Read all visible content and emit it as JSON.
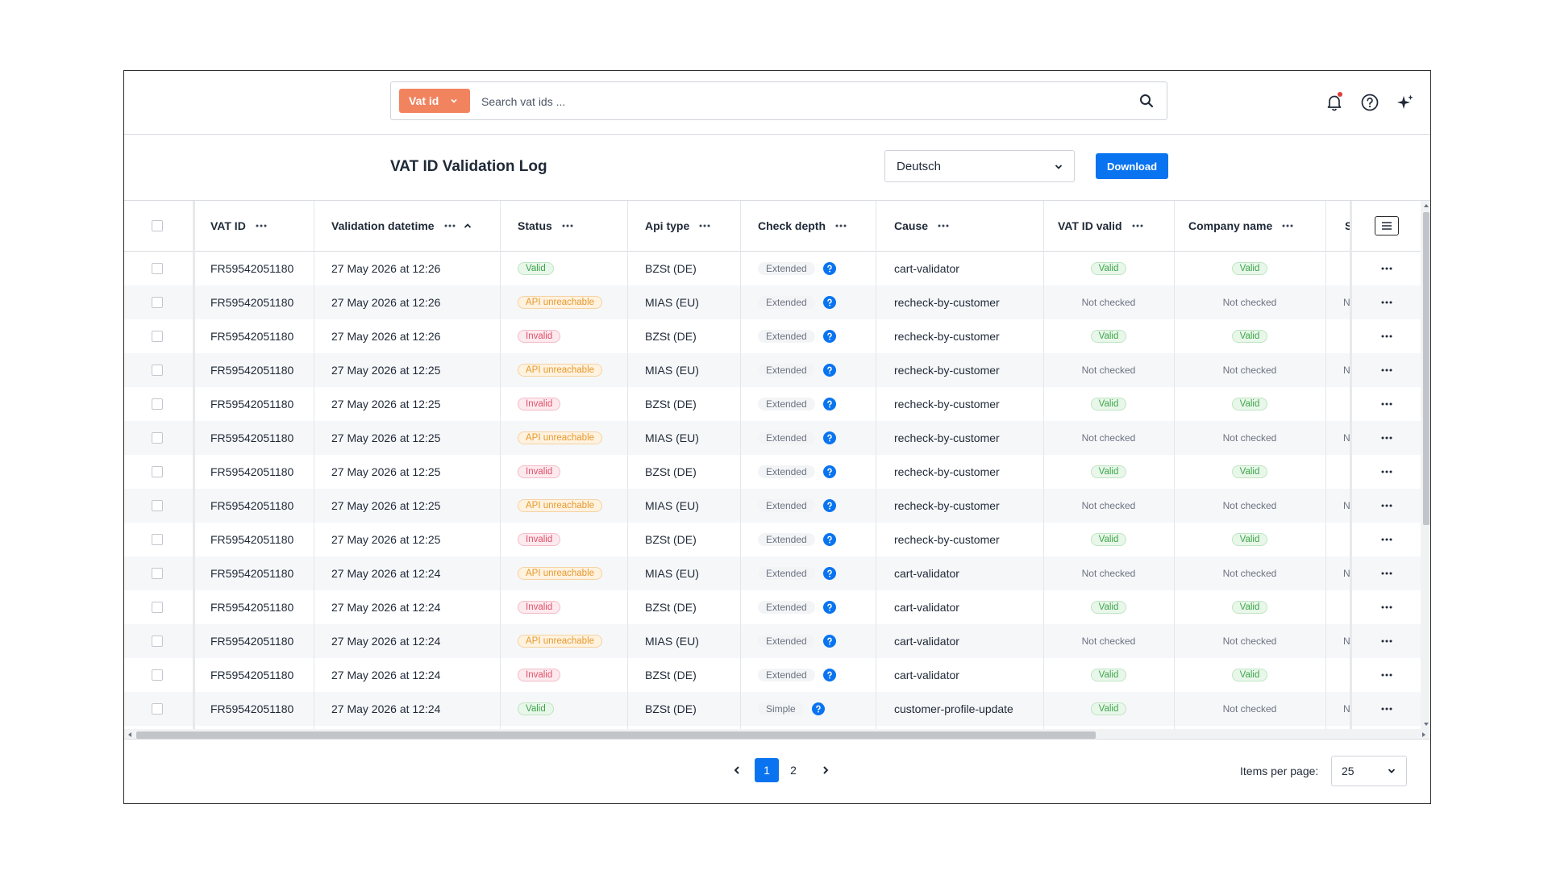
{
  "search": {
    "type_label": "Vat id",
    "placeholder": "Search vat ids ..."
  },
  "header": {
    "title": "VAT ID Validation Log",
    "language": "Deutsch",
    "download_label": "Download"
  },
  "table": {
    "columns": [
      {
        "key": "vat_id",
        "label": "VAT ID"
      },
      {
        "key": "validation_datetime",
        "label": "Validation datetime"
      },
      {
        "key": "status",
        "label": "Status"
      },
      {
        "key": "api_type",
        "label": "Api type"
      },
      {
        "key": "check_depth",
        "label": "Check depth"
      },
      {
        "key": "cause",
        "label": "Cause"
      },
      {
        "key": "vat_id_valid",
        "label": "VAT ID valid"
      },
      {
        "key": "company_name",
        "label": "Company name"
      },
      {
        "key": "partial",
        "label": "S"
      }
    ],
    "rows": [
      {
        "vat_id": "FR59542051180",
        "datetime": "27 May 2026 at 12:26",
        "status": "Valid",
        "api_type": "BZSt (DE)",
        "check_depth": "Extended",
        "cause": "cart-validator",
        "vat_id_valid": "Valid",
        "company_name": "Valid",
        "partial": ""
      },
      {
        "vat_id": "FR59542051180",
        "datetime": "27 May 2026 at 12:26",
        "status": "API unreachable",
        "api_type": "MIAS (EU)",
        "check_depth": "Extended",
        "cause": "recheck-by-customer",
        "vat_id_valid": "Not checked",
        "company_name": "Not checked",
        "partial": "N"
      },
      {
        "vat_id": "FR59542051180",
        "datetime": "27 May 2026 at 12:26",
        "status": "Invalid",
        "api_type": "BZSt (DE)",
        "check_depth": "Extended",
        "cause": "recheck-by-customer",
        "vat_id_valid": "Valid",
        "company_name": "Valid",
        "partial": ""
      },
      {
        "vat_id": "FR59542051180",
        "datetime": "27 May 2026 at 12:25",
        "status": "API unreachable",
        "api_type": "MIAS (EU)",
        "check_depth": "Extended",
        "cause": "recheck-by-customer",
        "vat_id_valid": "Not checked",
        "company_name": "Not checked",
        "partial": "N"
      },
      {
        "vat_id": "FR59542051180",
        "datetime": "27 May 2026 at 12:25",
        "status": "Invalid",
        "api_type": "BZSt (DE)",
        "check_depth": "Extended",
        "cause": "recheck-by-customer",
        "vat_id_valid": "Valid",
        "company_name": "Valid",
        "partial": ""
      },
      {
        "vat_id": "FR59542051180",
        "datetime": "27 May 2026 at 12:25",
        "status": "API unreachable",
        "api_type": "MIAS (EU)",
        "check_depth": "Extended",
        "cause": "recheck-by-customer",
        "vat_id_valid": "Not checked",
        "company_name": "Not checked",
        "partial": "N"
      },
      {
        "vat_id": "FR59542051180",
        "datetime": "27 May 2026 at 12:25",
        "status": "Invalid",
        "api_type": "BZSt (DE)",
        "check_depth": "Extended",
        "cause": "recheck-by-customer",
        "vat_id_valid": "Valid",
        "company_name": "Valid",
        "partial": ""
      },
      {
        "vat_id": "FR59542051180",
        "datetime": "27 May 2026 at 12:25",
        "status": "API unreachable",
        "api_type": "MIAS (EU)",
        "check_depth": "Extended",
        "cause": "recheck-by-customer",
        "vat_id_valid": "Not checked",
        "company_name": "Not checked",
        "partial": "N"
      },
      {
        "vat_id": "FR59542051180",
        "datetime": "27 May 2026 at 12:25",
        "status": "Invalid",
        "api_type": "BZSt (DE)",
        "check_depth": "Extended",
        "cause": "recheck-by-customer",
        "vat_id_valid": "Valid",
        "company_name": "Valid",
        "partial": ""
      },
      {
        "vat_id": "FR59542051180",
        "datetime": "27 May 2026 at 12:24",
        "status": "API unreachable",
        "api_type": "MIAS (EU)",
        "check_depth": "Extended",
        "cause": "cart-validator",
        "vat_id_valid": "Not checked",
        "company_name": "Not checked",
        "partial": "N"
      },
      {
        "vat_id": "FR59542051180",
        "datetime": "27 May 2026 at 12:24",
        "status": "Invalid",
        "api_type": "BZSt (DE)",
        "check_depth": "Extended",
        "cause": "cart-validator",
        "vat_id_valid": "Valid",
        "company_name": "Valid",
        "partial": ""
      },
      {
        "vat_id": "FR59542051180",
        "datetime": "27 May 2026 at 12:24",
        "status": "API unreachable",
        "api_type": "MIAS (EU)",
        "check_depth": "Extended",
        "cause": "cart-validator",
        "vat_id_valid": "Not checked",
        "company_name": "Not checked",
        "partial": "N"
      },
      {
        "vat_id": "FR59542051180",
        "datetime": "27 May 2026 at 12:24",
        "status": "Invalid",
        "api_type": "BZSt (DE)",
        "check_depth": "Extended",
        "cause": "cart-validator",
        "vat_id_valid": "Valid",
        "company_name": "Valid",
        "partial": ""
      },
      {
        "vat_id": "FR59542051180",
        "datetime": "27 May 2026 at 12:24",
        "status": "Valid",
        "api_type": "BZSt (DE)",
        "check_depth": "Simple",
        "cause": "customer-profile-update",
        "vat_id_valid": "Valid",
        "company_name": "Not checked",
        "partial": "N"
      }
    ]
  },
  "pagination": {
    "prev_icon": "chevron-left-icon",
    "next_icon": "chevron-right-icon",
    "pages": [
      "1",
      "2"
    ],
    "current": "1"
  },
  "items_per_page": {
    "label": "Items per page:",
    "value": "25"
  },
  "icons": {
    "bell": "bell-icon",
    "help": "help-circle-icon",
    "ai": "sparkle-icon",
    "search": "search-icon"
  },
  "colors": {
    "accent": "#0a74f0",
    "search_type": "#f2835f",
    "valid": "#3ea64b",
    "invalid": "#e0506a",
    "api_unreachable": "#e79a2f",
    "notification_dot": "#e23b3b"
  }
}
